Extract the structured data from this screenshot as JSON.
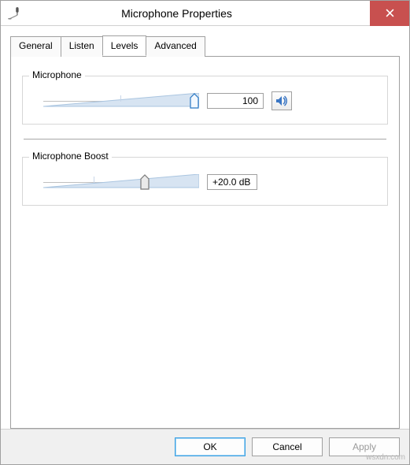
{
  "window": {
    "title": "Microphone Properties"
  },
  "tabs": {
    "general": "General",
    "listen": "Listen",
    "levels": "Levels",
    "advanced": "Advanced",
    "active": "levels"
  },
  "microphone": {
    "group_label": "Microphone",
    "value_display": "100",
    "slider_percent": 100
  },
  "boost": {
    "group_label": "Microphone Boost",
    "value_display": "+20.0 dB",
    "slider_percent": 66
  },
  "buttons": {
    "ok": "OK",
    "cancel": "Cancel",
    "apply": "Apply"
  },
  "watermark": "wsxdn.com"
}
